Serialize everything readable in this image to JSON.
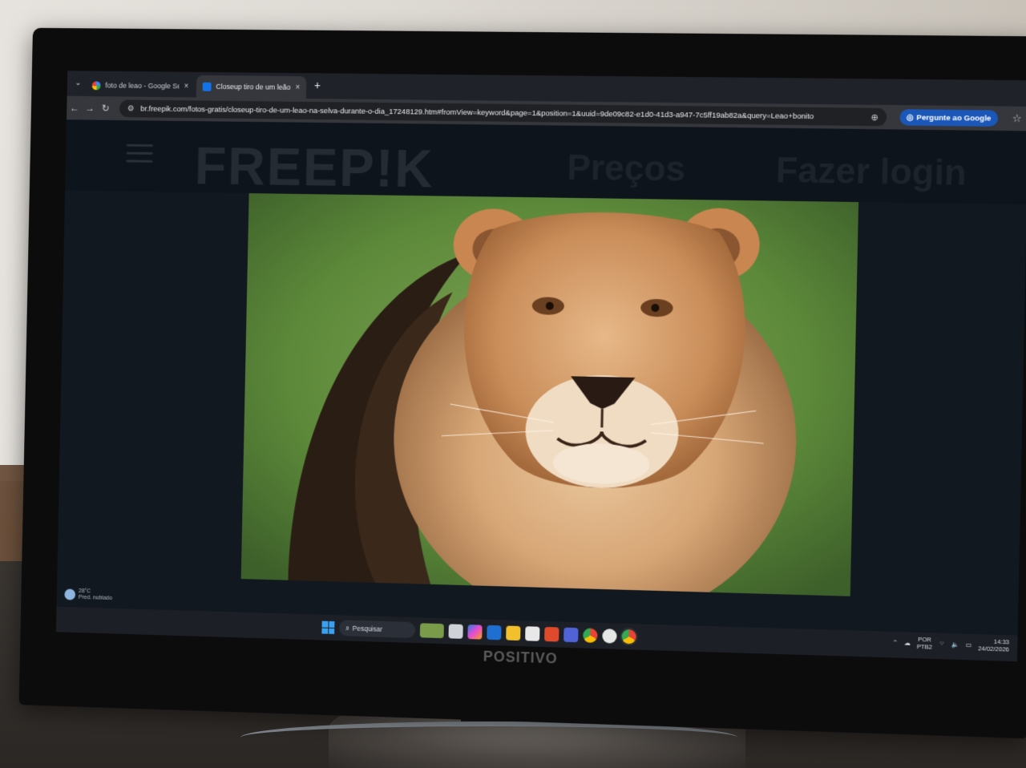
{
  "browser": {
    "tabs": [
      {
        "label": "foto de leao - Google Search",
        "favicon": "google-icon",
        "active": false
      },
      {
        "label": "Closeup tiro de um leão na selv",
        "favicon": "freepik-icon",
        "active": true
      }
    ],
    "new_tab": "+",
    "close_glyph": "×",
    "address_url": "br.freepik.com/fotos-gratis/closeup-tiro-de-um-leao-na-selva-durante-o-dia_17248129.htm#fromView=keyword&page=1&position=1&uuid=9de09c82-e1d0-41d3-a947-7c5ff19ab82a&query=Leao+bonito",
    "ask_google_label": "Pergunte ao Google"
  },
  "site": {
    "logo": "FREEP!K",
    "nav": {
      "pricing": "Preços",
      "login": "Fazer login"
    }
  },
  "taskbar": {
    "weather": {
      "temp": "28°C",
      "desc": "Pred. nublado"
    },
    "search_label": "Pesquisar",
    "language": {
      "line1": "POR",
      "line2": "PTB2"
    },
    "time": "14:33",
    "date": "24/02/2026"
  },
  "monitor": {
    "brand": "POSITIVO"
  },
  "colors": {
    "accent": "#1a57b8",
    "page_bg": "#111820"
  }
}
